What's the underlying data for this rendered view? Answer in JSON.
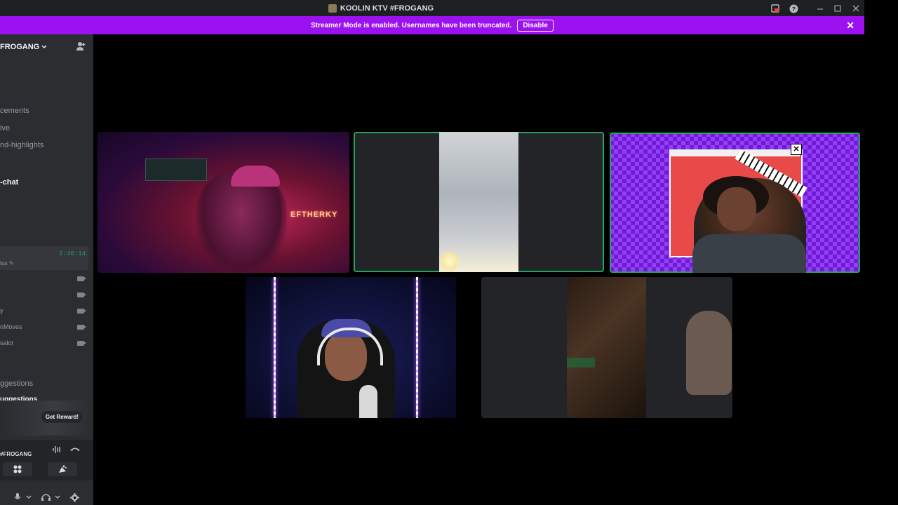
{
  "window": {
    "title": "KOOLIN KTV #FROGANG"
  },
  "banner": {
    "message": "Streamer Mode is enabled. Usernames have been truncated.",
    "disable_label": "Disable",
    "color": "#9b11f0"
  },
  "sidebar": {
    "server_name": "FROGANG",
    "channels": [
      {
        "label": "cements"
      },
      {
        "label": "ive"
      },
      {
        "label": "nd-highlights"
      },
      {
        "label": "-chat"
      }
    ],
    "voice": {
      "timer": "2:46:14",
      "status": "tus"
    },
    "members": [
      {
        "label": ""
      },
      {
        "label": ""
      },
      {
        "label": "y"
      },
      {
        "label": "nMoves"
      },
      {
        "label": "salot"
      }
    ],
    "bottom_channels": [
      {
        "label": "ggestions"
      },
      {
        "label": "uggestions"
      }
    ],
    "reward_button": "Get Reward!",
    "voice_panel_name": "#FROGANG"
  },
  "tiles": [
    {
      "name": "stream-1",
      "neon_text": "EFTHERKY"
    },
    {
      "name": "stream-2"
    },
    {
      "name": "stream-3"
    },
    {
      "name": "stream-4"
    },
    {
      "name": "stream-5"
    }
  ],
  "colors": {
    "speaking_outline": "#23a55a",
    "sidebar_bg": "#2b2d31",
    "titlebar_bg": "#1e1f22"
  }
}
